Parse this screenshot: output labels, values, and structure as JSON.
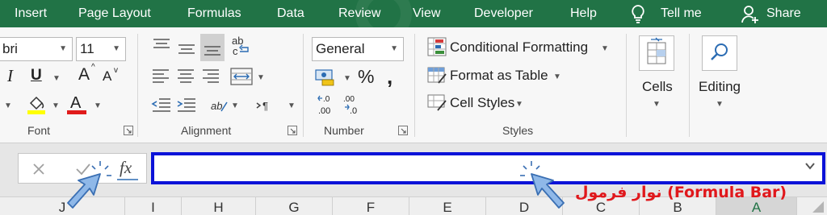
{
  "menu": {
    "items": [
      "Insert",
      "Page Layout",
      "Formulas",
      "Data",
      "Review",
      "View",
      "Developer",
      "Help"
    ],
    "tell_me": "Tell me",
    "share": "Share"
  },
  "ribbon": {
    "font": {
      "name_value": "bri",
      "size_value": "11",
      "group_label": "Font",
      "bold_letter": "I",
      "underline_letter": "U",
      "grow_letter": "A",
      "shrink_letter": "A",
      "fill_color": "#ffff00",
      "text_color": "#e01b1b"
    },
    "alignment": {
      "group_label": "Alignment"
    },
    "number": {
      "format_value": "General",
      "percent": "%",
      "comma": "̸",
      "group_label": "Number"
    },
    "styles": {
      "conditional_formatting": "Conditional Formatting",
      "format_as_table": "Format as Table",
      "cell_styles": "Cell Styles",
      "group_label": "Styles"
    },
    "cells": {
      "label": "Cells"
    },
    "editing": {
      "label": "Editing"
    }
  },
  "formula_bar": {
    "value": "",
    "annotation": "نوار فرمول (Formula Bar)"
  },
  "columns": [
    "J",
    "I",
    "H",
    "G",
    "F",
    "E",
    "D",
    "C",
    "B",
    "A"
  ],
  "colors": {
    "accent": "#217346",
    "highlight_border": "#0b12d8",
    "annotation": "#e0181c",
    "cursor_fill": "#8fb8e8",
    "cursor_stroke": "#3a6fb3"
  }
}
